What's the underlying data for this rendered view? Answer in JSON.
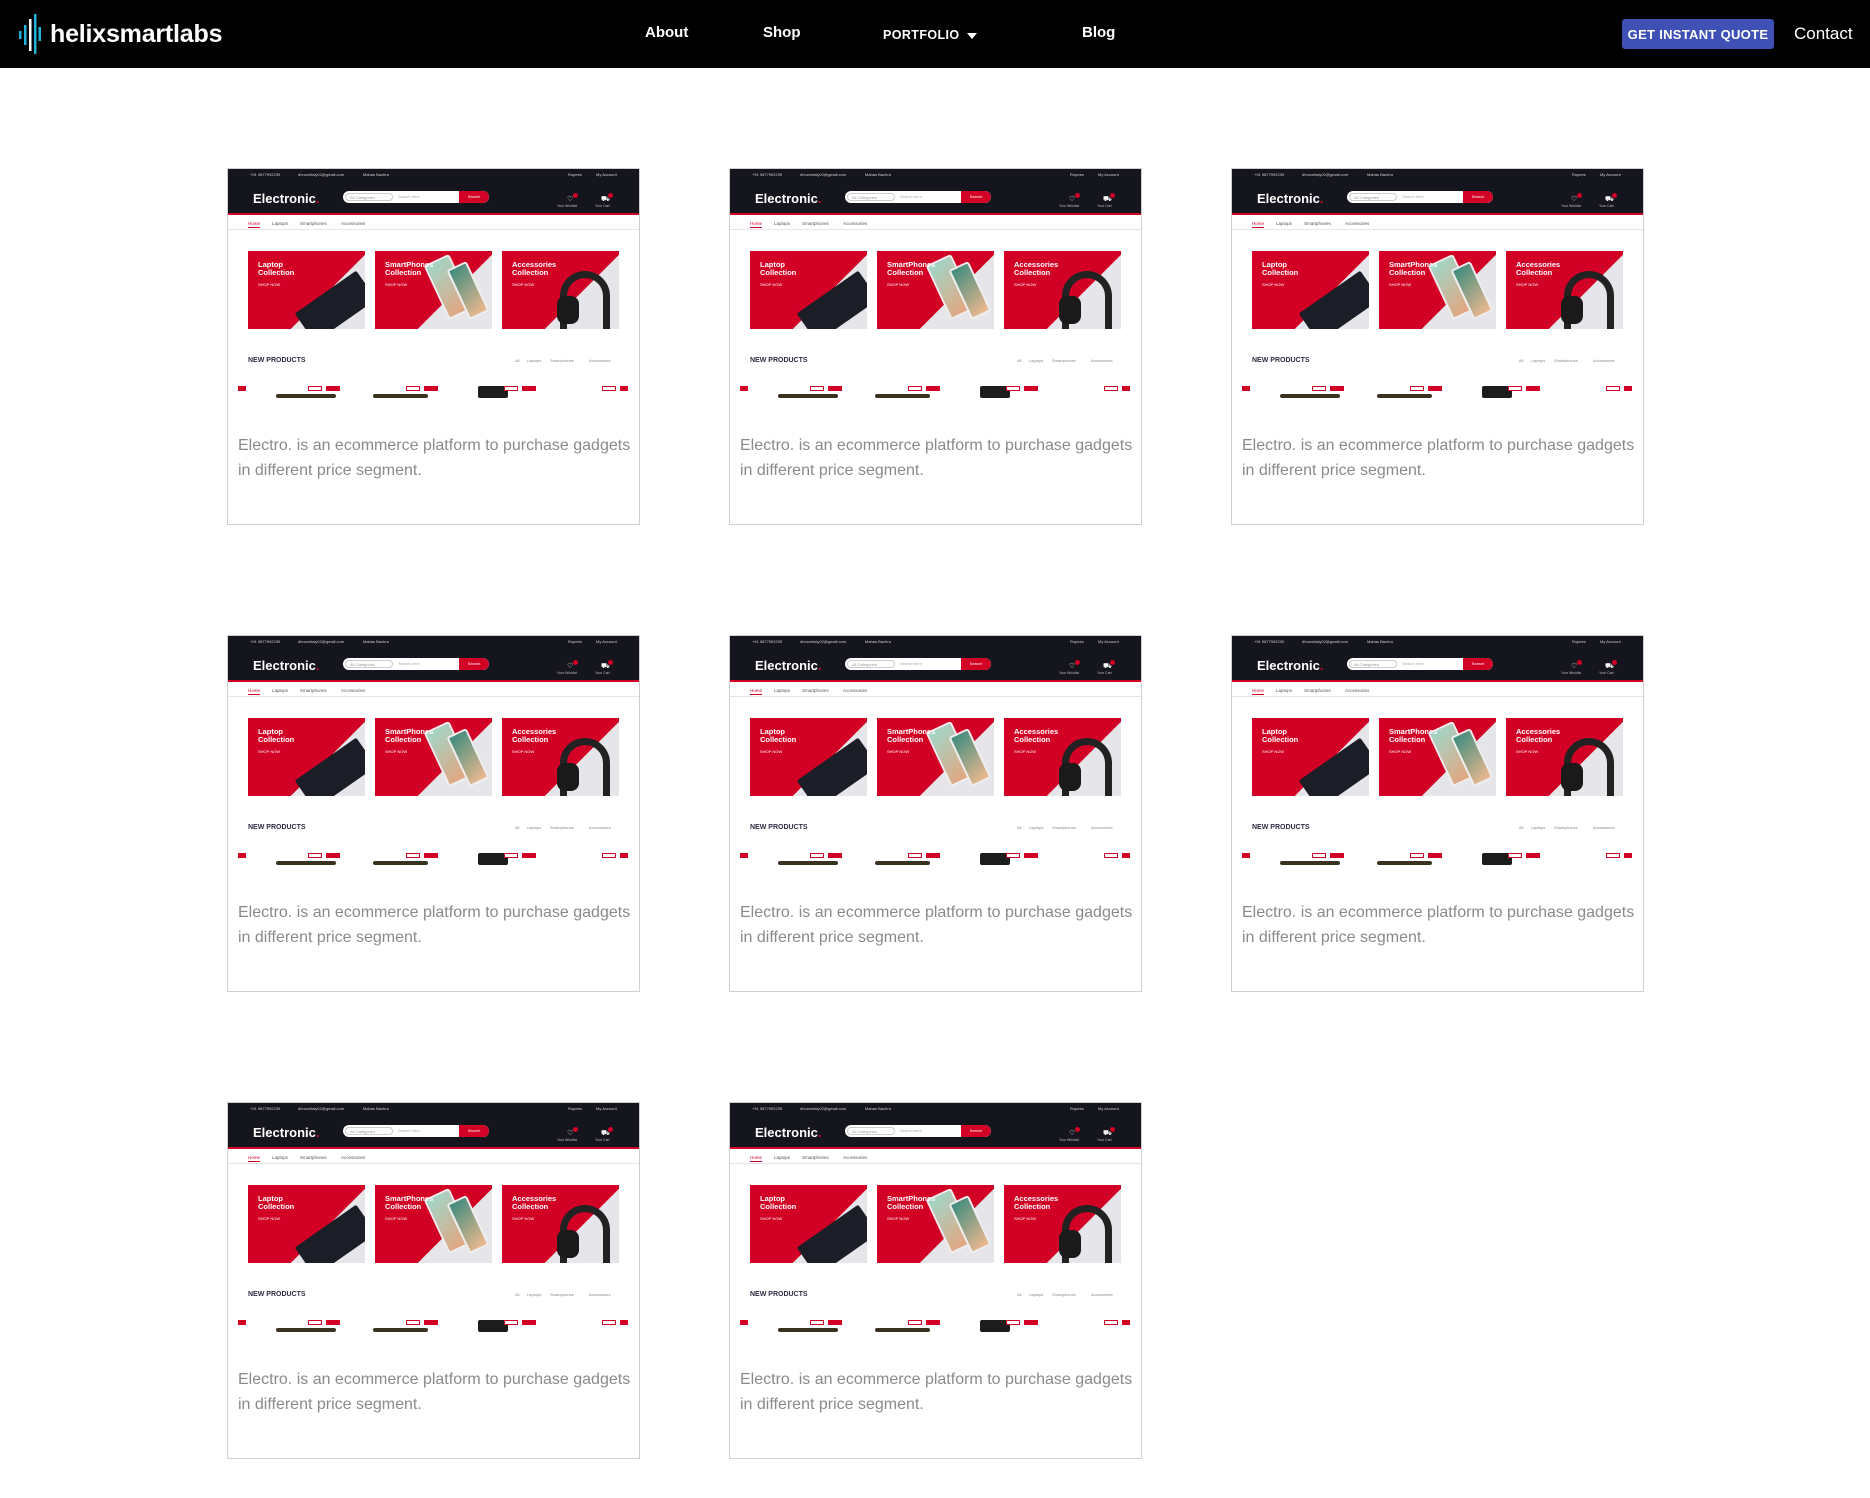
{
  "brand": {
    "name": "helixsmartlabs"
  },
  "nav": {
    "about": "About",
    "shop": "Shop",
    "portfolio": "PORTFOLIO",
    "blog": "Blog",
    "quote_button": "GET INSTANT QUOTE",
    "contact": "Contact"
  },
  "colors": {
    "nav_bg": "#000000",
    "quote_button": "#3f51b5",
    "thumb_accent": "#d10024",
    "thumb_dark": "#15161d",
    "desc_text": "#8a8a8a"
  },
  "portfolio_items": [
    {
      "description": "Electro. is an ecommerce platform to purchase gadgets in different price segment."
    },
    {
      "description": "Electro. is an ecommerce platform to purchase gadgets in different price segment."
    },
    {
      "description": "Electro. is an ecommerce platform to purchase gadgets in different price segment."
    },
    {
      "description": "Electro. is an ecommerce platform to purchase gadgets in different price segment."
    },
    {
      "description": "Electro. is an ecommerce platform to purchase gadgets in different price segment."
    },
    {
      "description": "Electro. is an ecommerce platform to purchase gadgets in different price segment."
    },
    {
      "description": "Electro. is an ecommerce platform to purchase gadgets in different price segment."
    },
    {
      "description": "Electro. is an ecommerce platform to purchase gadgets in different price segment."
    }
  ],
  "thumbnail": {
    "phone": "+91 9877992239",
    "email": "dhruvnitaly02@gmail.com",
    "location": "Mahas Bachra",
    "currency": "Rupees",
    "account": "My Account",
    "brand": "Electronic",
    "brand_dot": ".",
    "category_select": "All Categories",
    "search_placeholder": "Search here",
    "search_button": "Search",
    "wishlist": "Your Wishlist",
    "cart": "Your Cart",
    "nav": [
      "Home",
      "Laptops",
      "Smartphones",
      "Accessories"
    ],
    "banners": [
      {
        "title_line1": "Laptop",
        "title_line2": "Collection",
        "cta": "SHOP NOW"
      },
      {
        "title_line1": "SmartPhones",
        "title_line2": "Collection",
        "cta": "SHOP NOW"
      },
      {
        "title_line1": "Accessories",
        "title_line2": "Collection",
        "cta": "SHOP NOW"
      }
    ],
    "new_products": "NEW PRODUCTS",
    "filters": [
      "All",
      "Laptops",
      "Smartphones",
      "Accessories"
    ],
    "badges": [
      "-30%",
      "NEW"
    ]
  }
}
